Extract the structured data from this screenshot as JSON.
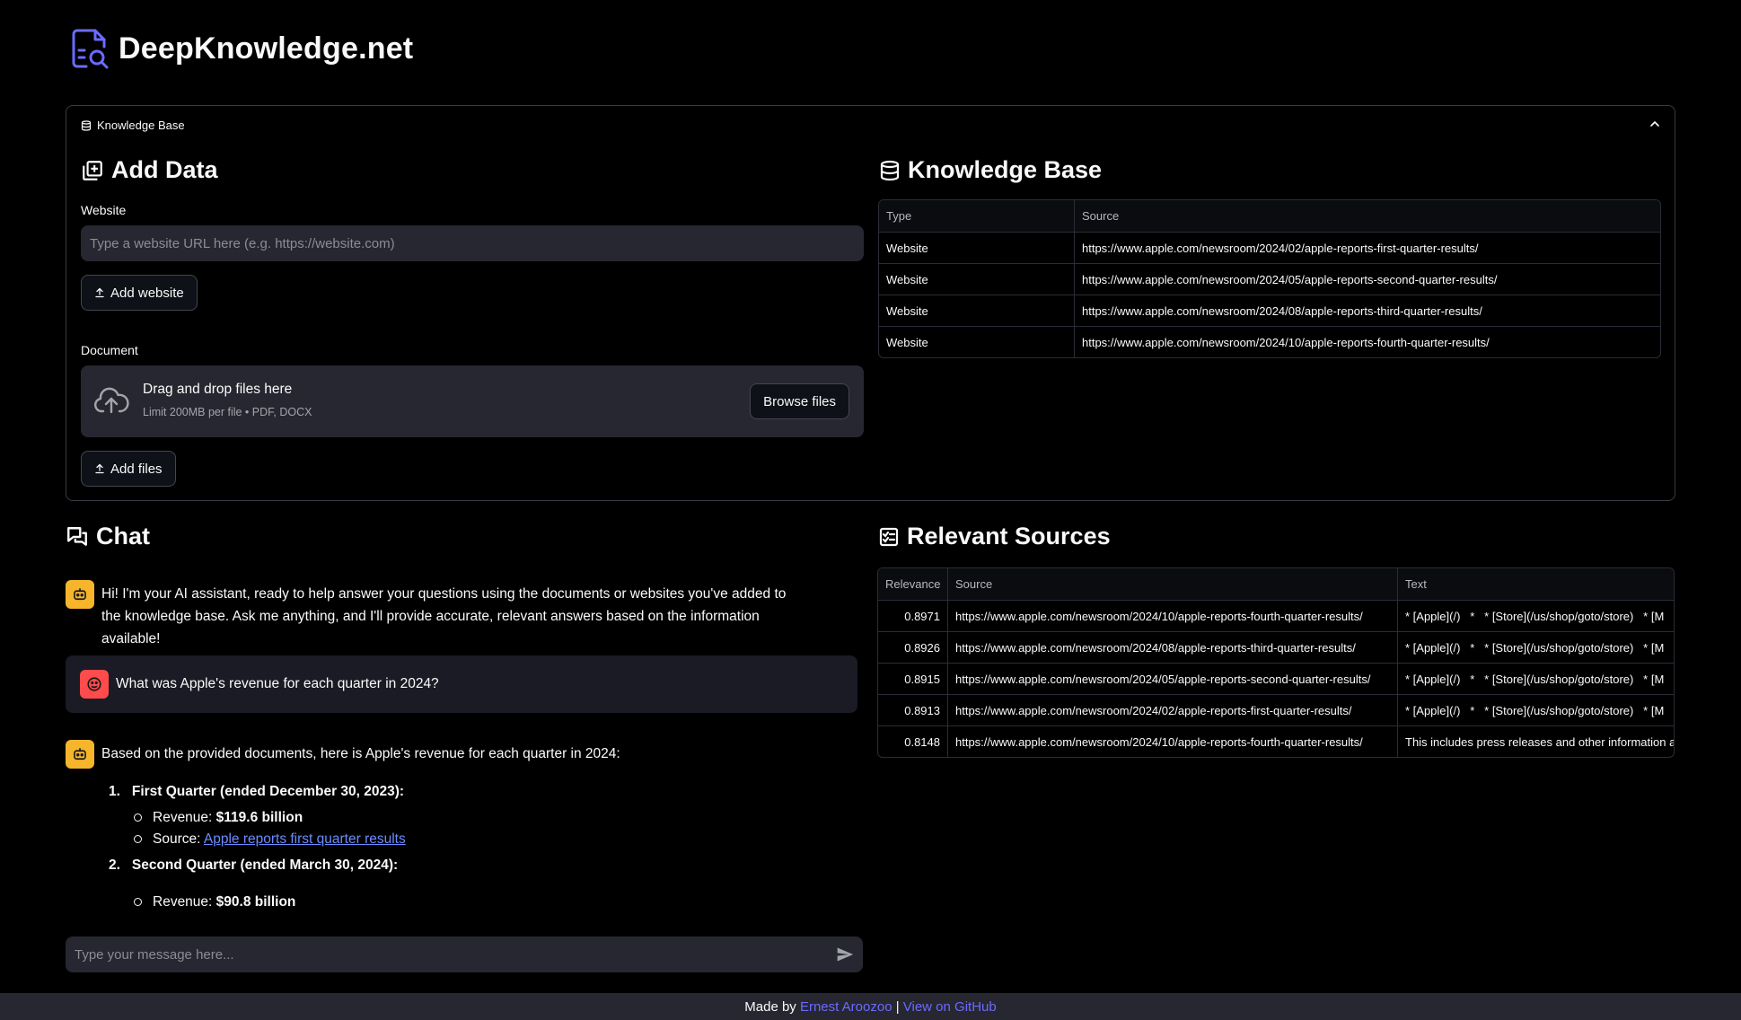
{
  "app": {
    "title": "DeepKnowledge.net"
  },
  "expander": {
    "label": "Knowledge Base"
  },
  "add_data": {
    "title": "Add Data",
    "website_label": "Website",
    "website_placeholder": "Type a website URL here (e.g. https://website.com)",
    "add_website_button": "Add website",
    "document_label": "Document",
    "dropzone_title": "Drag and drop files here",
    "dropzone_limit": "Limit 200MB per file • PDF, DOCX",
    "browse_button": "Browse files",
    "add_files_button": "Add files"
  },
  "knowledge_base": {
    "title": "Knowledge Base",
    "columns": [
      "Type",
      "Source"
    ],
    "rows": [
      [
        "Website",
        "https://www.apple.com/newsroom/2024/02/apple-reports-first-quarter-results/"
      ],
      [
        "Website",
        "https://www.apple.com/newsroom/2024/05/apple-reports-second-quarter-results/"
      ],
      [
        "Website",
        "https://www.apple.com/newsroom/2024/08/apple-reports-third-quarter-results/"
      ],
      [
        "Website",
        "https://www.apple.com/newsroom/2024/10/apple-reports-fourth-quarter-results/"
      ]
    ]
  },
  "chat": {
    "title": "Chat",
    "greeting": "Hi! I'm your AI assistant, ready to help answer your questions using the documents or websites you've added to the knowledge base. Ask me anything, and I'll provide accurate, relevant answers based on the information available!",
    "user_question": "What was Apple's revenue for each quarter in 2024?",
    "answer_intro": "Based on the provided documents, here is Apple's revenue for each quarter in 2024:",
    "q1_heading": "First Quarter (ended December 30, 2023):",
    "q1_revenue_label": "Revenue: ",
    "q1_revenue_value": "$119.6 billion",
    "q1_source_label": "Source: ",
    "q1_source_link": "Apple reports first quarter results",
    "q2_heading": "Second Quarter (ended March 30, 2024):",
    "q2_revenue_label": "Revenue: ",
    "q2_revenue_value": "$90.8 billion",
    "input_placeholder": "Type your message here..."
  },
  "relevant_sources": {
    "title": "Relevant Sources",
    "columns": [
      "Relevance",
      "Source",
      "Text"
    ],
    "rows": [
      [
        "0.8971",
        "https://www.apple.com/newsroom/2024/10/apple-reports-fourth-quarter-results/",
        "* [Apple](/)   *   * [Store](/us/shop/goto/store)   * [M"
      ],
      [
        "0.8926",
        "https://www.apple.com/newsroom/2024/08/apple-reports-third-quarter-results/",
        "* [Apple](/)   *   * [Store](/us/shop/goto/store)   * [M"
      ],
      [
        "0.8915",
        "https://www.apple.com/newsroom/2024/05/apple-reports-second-quarter-results/",
        "* [Apple](/)   *   * [Store](/us/shop/goto/store)   * [M"
      ],
      [
        "0.8913",
        "https://www.apple.com/newsroom/2024/02/apple-reports-first-quarter-results/",
        "* [Apple](/)   *   * [Store](/us/shop/goto/store)   * [M"
      ],
      [
        "0.8148",
        "https://www.apple.com/newsroom/2024/10/apple-reports-fourth-quarter-results/",
        "This includes press releases and other information a"
      ]
    ]
  },
  "footer": {
    "made_by": "Made by ",
    "author": "Ernest Aroozoo",
    "separator": " | ",
    "github": "View on GitHub"
  },
  "colors": {
    "accent": "#6b6bff",
    "ai_avatar": "#f7b52c",
    "user_avatar": "#ff4b4b",
    "input_bg": "#262730"
  }
}
